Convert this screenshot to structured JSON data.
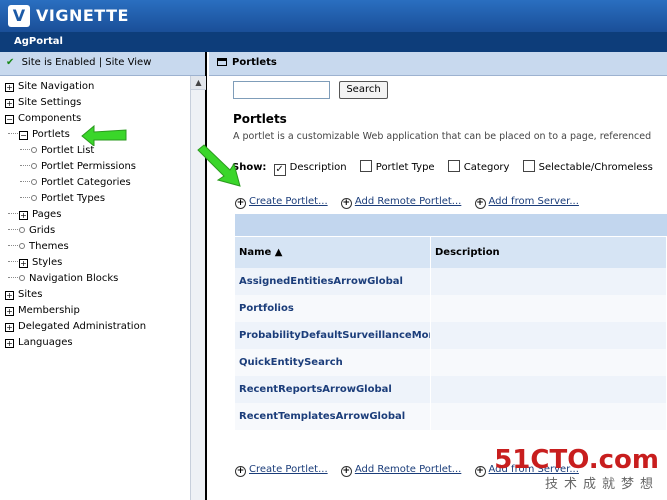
{
  "brand": {
    "name": "VIGNETTE",
    "logo_letter": "V"
  },
  "app": {
    "name": "AgPortal"
  },
  "left": {
    "status_text": "Site is Enabled | Site View",
    "tree": [
      {
        "label": "Site Navigation",
        "type": "expand"
      },
      {
        "label": "Site Settings",
        "type": "expand"
      },
      {
        "label": "Components",
        "type": "collapse"
      },
      {
        "label": "Portlets",
        "type": "collapse"
      },
      {
        "label": "Portlet List",
        "type": "leaf"
      },
      {
        "label": "Portlet Permissions",
        "type": "leaf"
      },
      {
        "label": "Portlet Categories",
        "type": "leaf"
      },
      {
        "label": "Portlet Types",
        "type": "leaf"
      },
      {
        "label": "Pages",
        "type": "expand"
      },
      {
        "label": "Grids",
        "type": "leaf"
      },
      {
        "label": "Themes",
        "type": "leaf"
      },
      {
        "label": "Styles",
        "type": "expand"
      },
      {
        "label": "Navigation Blocks",
        "type": "leaf"
      },
      {
        "label": "Sites",
        "type": "expand"
      },
      {
        "label": "Membership",
        "type": "expand"
      },
      {
        "label": "Delegated Administration",
        "type": "expand"
      },
      {
        "label": "Languages",
        "type": "expand"
      }
    ]
  },
  "right": {
    "header": "Portlets",
    "search": {
      "value": "",
      "button": "Search"
    },
    "title": "Portlets",
    "subtitle": "A portlet is a customizable Web application that can be placed on to a page, referenced",
    "show": {
      "label": "Show:",
      "options": [
        {
          "label": "Description",
          "checked": true
        },
        {
          "label": "Portlet Type",
          "checked": false
        },
        {
          "label": "Category",
          "checked": false
        },
        {
          "label": "Selectable/Chromeless",
          "checked": false
        }
      ]
    },
    "links": {
      "create": "Create Portlet...",
      "add_remote": "Add Remote Portlet...",
      "add_server": "Add from Server..."
    },
    "table": {
      "col_name": "Name ▲",
      "col_desc": "Description",
      "rows": [
        "AssignedEntitiesArrowGlobal",
        "Portfolios",
        "ProbabilityDefaultSurveillanceMonitor",
        "QuickEntitySearch",
        "RecentReportsArrowGlobal",
        "RecentTemplatesArrowGlobal"
      ]
    }
  },
  "watermark": {
    "main": "51CTO",
    "suffix": ".com",
    "sub": "技术成就梦想"
  },
  "colors": {
    "brand_blue": "#1d5aa6",
    "header_blue": "#c8d9ee",
    "arrow_green": "#3ad62a",
    "link": "#1b3d7a",
    "watermark_red": "#c81e1e"
  }
}
